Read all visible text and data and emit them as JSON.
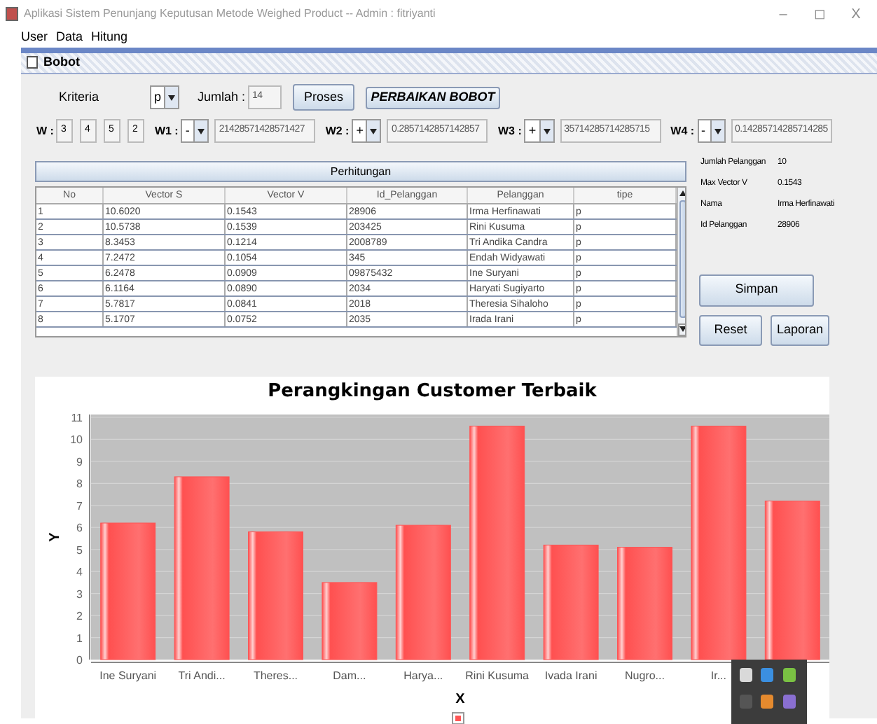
{
  "window": {
    "title": "Aplikasi Sistem Penunjang Keputusan Metode Weighed Product -- Admin : fitriyanti",
    "controls": [
      "–",
      "◻",
      "X"
    ]
  },
  "menu": [
    "User",
    "Data",
    "Hitung"
  ],
  "internal_frame": {
    "title": "Bobot"
  },
  "kriteria": {
    "label": "Kriteria",
    "value": "p",
    "jumlah_label": "Jumlah :",
    "jumlah_value": "14"
  },
  "buttons": {
    "proses": "Proses",
    "perbaikan": "PERBAIKAN BOBOT",
    "simpan": "Simpan",
    "reset": "Reset",
    "laporan": "Laporan"
  },
  "weights": {
    "label": "W :",
    "values": [
      "3",
      "4",
      "5",
      "2"
    ]
  },
  "normalized": [
    {
      "label": "W1 :",
      "sign": "-",
      "value": "21428571428571427"
    },
    {
      "label": "W2 :",
      "sign": "+",
      "value": "0.2857142857142857"
    },
    {
      "label": "W3 :",
      "sign": "+",
      "value": "35714285714285715"
    },
    {
      "label": "W4 :",
      "sign": "-",
      "value": "0.14285714285714285"
    }
  ],
  "table": {
    "title": "Perhitungan",
    "columns": [
      "No",
      "Vector S",
      "Vector V",
      "Id_Pelanggan",
      "Pelanggan",
      "tipe"
    ],
    "rows": [
      [
        "1",
        "10.6020",
        "0.1543",
        "28906",
        "Irma Herfinawati",
        "p"
      ],
      [
        "2",
        "10.5738",
        "0.1539",
        "203425",
        "Rini Kusuma",
        "p"
      ],
      [
        "3",
        "8.3453",
        "0.1214",
        "2008789",
        "Tri Andika Candra",
        "p"
      ],
      [
        "4",
        "7.2472",
        "0.1054",
        "345",
        "Endah Widyawati",
        "p"
      ],
      [
        "5",
        "6.2478",
        "0.0909",
        "09875432",
        "Ine Suryani",
        "p"
      ],
      [
        "6",
        "6.1164",
        "0.0890",
        "2034",
        "Haryati Sugiyarto",
        "p"
      ],
      [
        "7",
        "5.7817",
        "0.0841",
        "2018",
        "Theresia Sihaloho",
        "p"
      ],
      [
        "8",
        "5.1707",
        "0.0752",
        "2035",
        "Irada Irani",
        "p"
      ]
    ]
  },
  "summary": [
    {
      "label": "Jumlah Pelanggan",
      "value": "10"
    },
    {
      "label": "Max Vector V",
      "value": "0.1543"
    },
    {
      "label": "Nama",
      "value": "Irma Herfinawati"
    },
    {
      "label": "Id Pelanggan",
      "value": "28906"
    }
  ],
  "chart": {
    "chart_data": {
      "type": "bar",
      "title": "Perangkingan Customer Terbaik",
      "xlabel": "X",
      "ylabel": "Y",
      "categories": [
        "Ine Suryani",
        "Tri Andi...",
        "Theres...",
        "Dam...",
        "Harya...",
        "Rini Kusuma",
        "Ivada Irani",
        "Nugro...",
        "Ir...",
        null
      ],
      "series": [
        {
          "color": "#ff5555",
          "values": [
            6.2,
            8.3,
            5.8,
            3.5,
            6.1,
            10.6,
            5.2,
            5.1,
            10.6,
            7.2
          ]
        }
      ],
      "grid": true,
      "ylim": [
        0,
        11
      ],
      "yticks": [
        0,
        1,
        2,
        3,
        4,
        5,
        6,
        7,
        8,
        9,
        10,
        11
      ]
    }
  }
}
